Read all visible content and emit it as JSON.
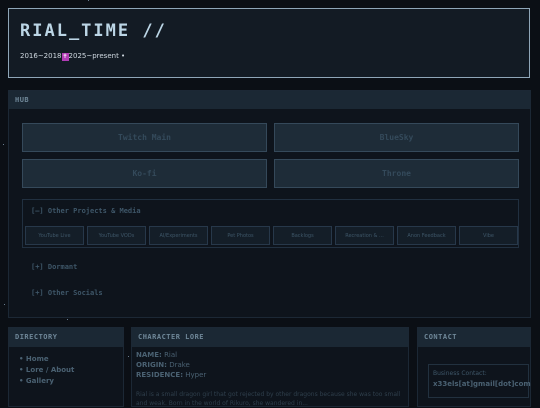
{
  "header": {
    "title": "RIAL_TIME //",
    "dates_start": "2016~2018",
    "dates_mark": "✝",
    "dates_end": "2025~present •"
  },
  "hub": {
    "title": "HUB",
    "buttons": [
      "Twitch Main",
      "BlueSky",
      "Ko-fi",
      "Throne"
    ],
    "other_projects_label": "[–] Other Projects & Media",
    "projects": [
      "YouTube Live",
      "YouTube VODs",
      "AI/Experiments",
      "Pet Photos",
      "Backlogs",
      "Recreation & ...",
      "Anon Feedback",
      "Vibe"
    ],
    "dormant_label": "[+] Dormant",
    "other_socials_label": "[+] Other Socials"
  },
  "directory": {
    "title": "DIRECTORY",
    "items": [
      "Home",
      "Lore / About",
      "Gallery"
    ]
  },
  "lore": {
    "title": "CHARACTER LORE",
    "name_key": "NAME:",
    "name_val": "Rial",
    "origin_key": "ORIGIN:",
    "origin_val": "Drake",
    "residence_key": "RESIDENCE:",
    "residence_val": "Hyper",
    "paragraph": "Rial is a small dragon girl that got rejected by other dragons because she was too small and weak. Born in the world of Rikuro, she wandered in..."
  },
  "contact": {
    "title": "CONTACT",
    "label": "Business Contact:",
    "email": "x33els[at]gmail[dot]com"
  }
}
